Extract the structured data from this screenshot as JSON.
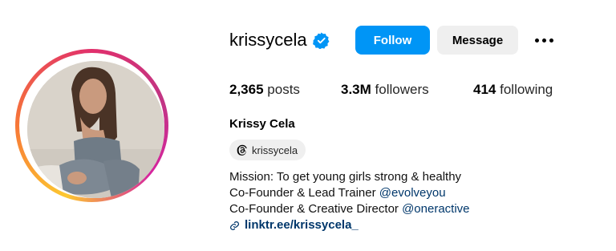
{
  "profile": {
    "username": "krissycela",
    "full_name": "Krissy Cela",
    "verified": true
  },
  "buttons": {
    "follow": "Follow",
    "message": "Message"
  },
  "stats": {
    "posts_count": "2,365",
    "posts_label": "posts",
    "followers_count": "3.3M",
    "followers_label": "followers",
    "following_count": "414",
    "following_label": "following"
  },
  "threads": {
    "handle": "krissycela",
    "icon": "threads-icon"
  },
  "bio": {
    "line1": "Mission: To get young girls strong & healthy",
    "line2_text": "Co-Founder & Lead Trainer ",
    "line2_mention": "@evolveyou",
    "line3_text": "Co-Founder & Creative Director ",
    "line3_mention": "@oneractive",
    "link": "linktr.ee/krissycela_"
  },
  "colors": {
    "follow_button": "#0095f6",
    "message_button": "#efefef",
    "mention": "#00376b",
    "verified_badge": "#0095f6"
  }
}
